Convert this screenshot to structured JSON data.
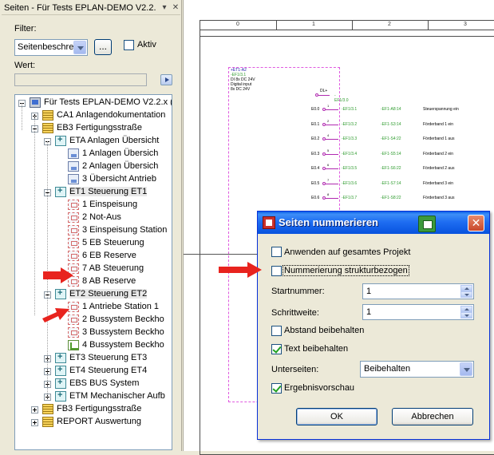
{
  "panel": {
    "title": "Seiten - Für Tests EPLAN-DEMO V2.2.",
    "filter_label": "Filter:",
    "filter_value": "Seitenbeschre",
    "filter_button": "...",
    "aktiv_label": "Aktiv",
    "wert_label": "Wert:",
    "wert_value": ""
  },
  "tree": [
    {
      "label": "Für Tests EPLAN-DEMO V2.2.x (",
      "icon": "project-icon"
    },
    {
      "label": "CA1 Anlagendokumentation",
      "icon": "folder-icon"
    },
    {
      "label": "EB3 Fertigungsstraße",
      "icon": "folder-icon"
    },
    {
      "label": "ETA Anlagen Übersicht",
      "icon": "structure-icon"
    },
    {
      "label": "1 Anlagen Übersich",
      "icon": "overview-page-icon"
    },
    {
      "label": "2 Anlagen Übersich",
      "icon": "overview-page-icon"
    },
    {
      "label": "3 Übersicht Antrieb",
      "icon": "overview-page-icon"
    },
    {
      "label": "ET1 Steuerung ET1",
      "icon": "structure-icon"
    },
    {
      "label": "1 Einspeisung",
      "icon": "schematic-page-icon"
    },
    {
      "label": "2 Not-Aus",
      "icon": "schematic-page-icon"
    },
    {
      "label": "3 Einspeisung Station",
      "icon": "schematic-page-icon"
    },
    {
      "label": "5 EB Steuerung",
      "icon": "schematic-page-icon"
    },
    {
      "label": "6 EB Reserve",
      "icon": "schematic-page-icon"
    },
    {
      "label": "7 AB Steuerung",
      "icon": "schematic-page-icon"
    },
    {
      "label": "8 AB Reserve",
      "icon": "schematic-page-icon"
    },
    {
      "label": "ET2 Steuerung ET2",
      "icon": "structure-icon"
    },
    {
      "label": "1 Antriebe Station 1",
      "icon": "schematic-page-icon"
    },
    {
      "label": "2 Bussystem Beckho",
      "icon": "schematic-page-icon"
    },
    {
      "label": "3 Bussystem Beckho",
      "icon": "schematic-page-icon"
    },
    {
      "label": "4 Bussystem Beckho",
      "icon": "graphic-page-icon"
    },
    {
      "label": "ET3 Steuerung ET3",
      "icon": "structure-icon"
    },
    {
      "label": "ET4 Steuerung ET4",
      "icon": "structure-icon"
    },
    {
      "label": "EBS BUS System",
      "icon": "structure-icon"
    },
    {
      "label": "ETM Mechanischer Aufb",
      "icon": "structure-icon"
    },
    {
      "label": "FB3 Fertigungsstraße",
      "icon": "folder-icon"
    },
    {
      "label": "REPORT Auswertung",
      "icon": "folder-icon"
    }
  ],
  "drawing": {
    "ruler": [
      "0",
      "1",
      "2",
      "3"
    ],
    "header_tag": [
      "+ET1-A2",
      "-EF1/3.1",
      "DI 8x DC 24V",
      "Digital input",
      "8x DC 24V"
    ],
    "top_signal": {
      "num": "DL+",
      "tag": "-EF1/3.0"
    },
    "signals": [
      {
        "pin": "E0.0",
        "num": "1",
        "tag": "-EF1/3.1",
        "tag2": "-EF1-A8:14",
        "desc": "Steuerspannung ein"
      },
      {
        "pin": "E0.1",
        "num": "2",
        "tag": "-EF1/3.2",
        "tag2": "-EF1-S3:14",
        "desc": "Förderband 1 ein"
      },
      {
        "pin": "E0.2",
        "num": "4",
        "tag": "-EF1/3.3",
        "tag2": "-EF1-S4:22",
        "desc": "Förderband 1 aus"
      },
      {
        "pin": "E0.3",
        "num": "5",
        "tag": "-EF1/3.4",
        "tag2": "-EF1-S5:14",
        "desc": "Förderband 2 ein"
      },
      {
        "pin": "E0.4",
        "num": "6",
        "tag": "-EF1/3.5",
        "tag2": "-EF1-S6:22",
        "desc": "Förderband 2 aus"
      },
      {
        "pin": "E0.5",
        "num": "7",
        "tag": "-EF1/3.6",
        "tag2": "-EF1-S7:14",
        "desc": "Förderband 3 ein"
      },
      {
        "pin": "E0.6",
        "num": "8",
        "tag": "-EF1/3.7",
        "tag2": "-EF1-S8:22",
        "desc": "Förderband 3 aus"
      }
    ]
  },
  "dialog": {
    "title": "Seiten nummerieren",
    "close": "✕",
    "anwenden_label": "Anwenden auf gesamtes Projekt",
    "anwenden_checked": false,
    "nummerierung_label": "Nummerierung strukturbezogen",
    "nummerierung_checked": false,
    "startnummer_label": "Startnummer:",
    "startnummer_value": "1",
    "schrittweite_label": "Schrittweite:",
    "schrittweite_value": "1",
    "abstand_label": "Abstand beibehalten",
    "abstand_checked": false,
    "text_label": "Text beibehalten",
    "text_checked": true,
    "unterseiten_label": "Unterseiten:",
    "unterseiten_value": "Beibehalten",
    "ergebnis_label": "Ergebnisvorschau",
    "ergebnis_checked": true,
    "ok_label": "OK",
    "abbrechen_label": "Abbrechen"
  },
  "colors": {
    "accent_arrow": "#e8231e",
    "titlebar": "#0a5fe8",
    "selection": "#e8e8e8"
  }
}
